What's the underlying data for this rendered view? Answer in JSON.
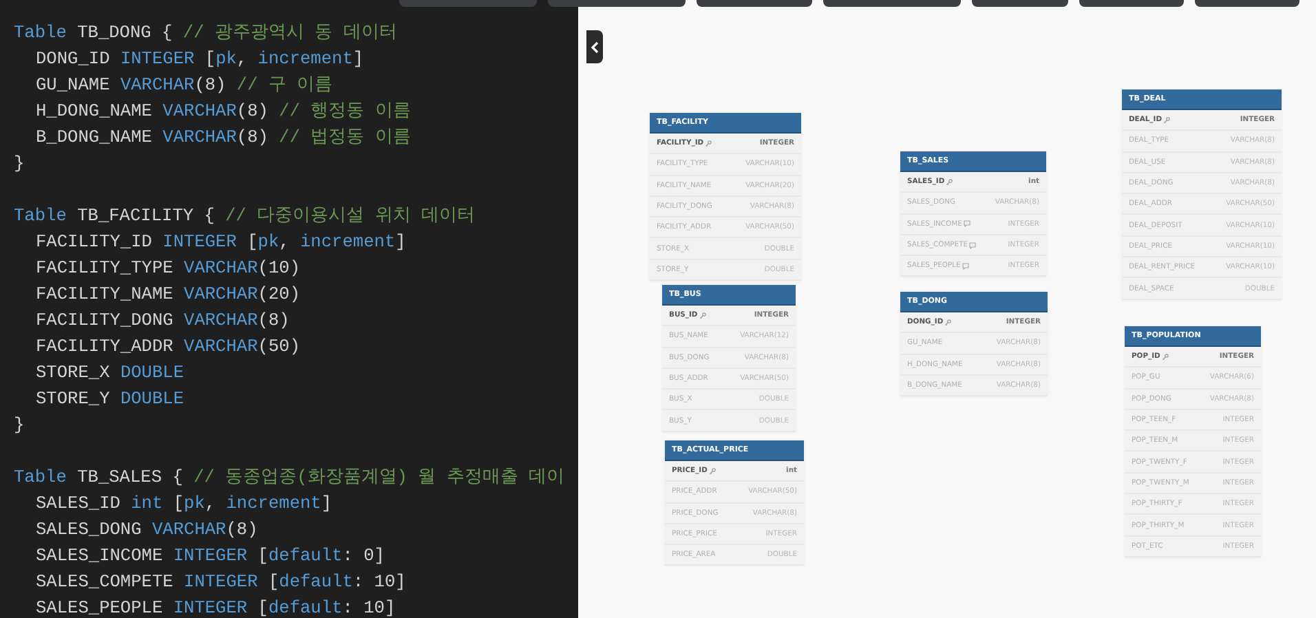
{
  "code": [
    {
      "kind": "code",
      "indented": false,
      "tokens": [
        {
          "kind": "kw",
          "text": "Table"
        },
        {
          "kind": "id",
          "text": " TB_DONG { "
        },
        {
          "kind": "cm",
          "text": "// 광주광역시 동 데이터"
        }
      ]
    },
    {
      "kind": "code",
      "indented": true,
      "tokens": [
        {
          "kind": "id",
          "text": "DONG_ID "
        },
        {
          "kind": "kw",
          "text": "INTEGER"
        },
        {
          "kind": "id",
          "text": " ["
        },
        {
          "kind": "kw",
          "text": "pk"
        },
        {
          "kind": "id",
          "text": ", "
        },
        {
          "kind": "kw",
          "text": "increment"
        },
        {
          "kind": "id",
          "text": "]"
        }
      ]
    },
    {
      "kind": "code",
      "indented": true,
      "tokens": [
        {
          "kind": "id",
          "text": "GU_NAME "
        },
        {
          "kind": "kw",
          "text": "VARCHAR"
        },
        {
          "kind": "id",
          "text": "(8) "
        },
        {
          "kind": "cm",
          "text": "// 구 이름"
        }
      ]
    },
    {
      "kind": "code",
      "indented": true,
      "tokens": [
        {
          "kind": "id",
          "text": "H_DONG_NAME "
        },
        {
          "kind": "kw",
          "text": "VARCHAR"
        },
        {
          "kind": "id",
          "text": "(8) "
        },
        {
          "kind": "cm",
          "text": "// 행정동 이름"
        }
      ]
    },
    {
      "kind": "code",
      "indented": true,
      "tokens": [
        {
          "kind": "id",
          "text": "B_DONG_NAME "
        },
        {
          "kind": "kw",
          "text": "VARCHAR"
        },
        {
          "kind": "id",
          "text": "(8) "
        },
        {
          "kind": "cm",
          "text": "// 법정동 이름"
        }
      ]
    },
    {
      "kind": "code",
      "indented": false,
      "tokens": [
        {
          "kind": "id",
          "text": "}"
        }
      ]
    },
    {
      "kind": "blank"
    },
    {
      "kind": "code",
      "indented": false,
      "tokens": [
        {
          "kind": "kw",
          "text": "Table"
        },
        {
          "kind": "id",
          "text": " TB_FACILITY { "
        },
        {
          "kind": "cm",
          "text": "// 다중이용시설 위치 데이터"
        }
      ]
    },
    {
      "kind": "code",
      "indented": true,
      "tokens": [
        {
          "kind": "id",
          "text": "FACILITY_ID "
        },
        {
          "kind": "kw",
          "text": "INTEGER"
        },
        {
          "kind": "id",
          "text": " ["
        },
        {
          "kind": "kw",
          "text": "pk"
        },
        {
          "kind": "id",
          "text": ", "
        },
        {
          "kind": "kw",
          "text": "increment"
        },
        {
          "kind": "id",
          "text": "]"
        }
      ]
    },
    {
      "kind": "code",
      "indented": true,
      "tokens": [
        {
          "kind": "id",
          "text": "FACILITY_TYPE "
        },
        {
          "kind": "kw",
          "text": "VARCHAR"
        },
        {
          "kind": "id",
          "text": "(10)"
        }
      ]
    },
    {
      "kind": "code",
      "indented": true,
      "tokens": [
        {
          "kind": "id",
          "text": "FACILITY_NAME "
        },
        {
          "kind": "kw",
          "text": "VARCHAR"
        },
        {
          "kind": "id",
          "text": "(20)"
        }
      ]
    },
    {
      "kind": "code",
      "indented": true,
      "tokens": [
        {
          "kind": "id",
          "text": "FACILITY_DONG "
        },
        {
          "kind": "kw",
          "text": "VARCHAR"
        },
        {
          "kind": "id",
          "text": "(8)"
        }
      ]
    },
    {
      "kind": "code",
      "indented": true,
      "tokens": [
        {
          "kind": "id",
          "text": "FACILITY_ADDR "
        },
        {
          "kind": "kw",
          "text": "VARCHAR"
        },
        {
          "kind": "id",
          "text": "(50)"
        }
      ]
    },
    {
      "kind": "code",
      "indented": true,
      "tokens": [
        {
          "kind": "id",
          "text": "STORE_X "
        },
        {
          "kind": "kw",
          "text": "DOUBLE"
        }
      ]
    },
    {
      "kind": "code",
      "indented": true,
      "tokens": [
        {
          "kind": "id",
          "text": "STORE_Y "
        },
        {
          "kind": "kw",
          "text": "DOUBLE"
        }
      ]
    },
    {
      "kind": "code",
      "indented": false,
      "tokens": [
        {
          "kind": "id",
          "text": "}"
        }
      ]
    },
    {
      "kind": "blank"
    },
    {
      "kind": "code",
      "indented": false,
      "tokens": [
        {
          "kind": "kw",
          "text": "Table"
        },
        {
          "kind": "id",
          "text": " TB_SALES { "
        },
        {
          "kind": "cm",
          "text": "// 동종업종(화장품계열) 월 추정매출 데이"
        }
      ]
    },
    {
      "kind": "code",
      "indented": true,
      "tokens": [
        {
          "kind": "id",
          "text": "SALES_ID "
        },
        {
          "kind": "kw",
          "text": "int"
        },
        {
          "kind": "id",
          "text": " ["
        },
        {
          "kind": "kw",
          "text": "pk"
        },
        {
          "kind": "id",
          "text": ", "
        },
        {
          "kind": "kw",
          "text": "increment"
        },
        {
          "kind": "id",
          "text": "]"
        }
      ]
    },
    {
      "kind": "code",
      "indented": true,
      "tokens": [
        {
          "kind": "id",
          "text": "SALES_DONG "
        },
        {
          "kind": "kw",
          "text": "VARCHAR"
        },
        {
          "kind": "id",
          "text": "(8)"
        }
      ]
    },
    {
      "kind": "code",
      "indented": true,
      "tokens": [
        {
          "kind": "id",
          "text": "SALES_INCOME "
        },
        {
          "kind": "kw",
          "text": "INTEGER"
        },
        {
          "kind": "id",
          "text": " ["
        },
        {
          "kind": "kw",
          "text": "default"
        },
        {
          "kind": "id",
          "text": ": 0]"
        }
      ]
    },
    {
      "kind": "code",
      "indented": true,
      "tokens": [
        {
          "kind": "id",
          "text": "SALES_COMPETE "
        },
        {
          "kind": "kw",
          "text": "INTEGER"
        },
        {
          "kind": "id",
          "text": " ["
        },
        {
          "kind": "kw",
          "text": "default"
        },
        {
          "kind": "id",
          "text": ": 10]"
        }
      ]
    },
    {
      "kind": "code",
      "indented": true,
      "tokens": [
        {
          "kind": "id",
          "text": "SALES_PEOPLE "
        },
        {
          "kind": "kw",
          "text": "INTEGER"
        },
        {
          "kind": "id",
          "text": " ["
        },
        {
          "kind": "kw",
          "text": "default"
        },
        {
          "kind": "id",
          "text": ": 10]"
        }
      ]
    }
  ],
  "tables": [
    {
      "name": "TB_FACILITY",
      "fields": [
        {
          "name": "FACILITY_ID",
          "type": "INTEGER",
          "pk": true,
          "note": false
        },
        {
          "name": "FACILITY_TYPE",
          "type": "VARCHAR(10)",
          "pk": false,
          "note": false
        },
        {
          "name": "FACILITY_NAME",
          "type": "VARCHAR(20)",
          "pk": false,
          "note": false
        },
        {
          "name": "FACILITY_DONG",
          "type": "VARCHAR(8)",
          "pk": false,
          "note": false
        },
        {
          "name": "FACILITY_ADDR",
          "type": "VARCHAR(50)",
          "pk": false,
          "note": false
        },
        {
          "name": "STORE_X",
          "type": "DOUBLE",
          "pk": false,
          "note": false
        },
        {
          "name": "STORE_Y",
          "type": "DOUBLE",
          "pk": false,
          "note": false
        }
      ]
    },
    {
      "name": "TB_BUS",
      "fields": [
        {
          "name": "BUS_ID",
          "type": "INTEGER",
          "pk": true,
          "note": false
        },
        {
          "name": "BUS_NAME",
          "type": "VARCHAR(12)",
          "pk": false,
          "note": false
        },
        {
          "name": "BUS_DONG",
          "type": "VARCHAR(8)",
          "pk": false,
          "note": false
        },
        {
          "name": "BUS_ADDR",
          "type": "VARCHAR(50)",
          "pk": false,
          "note": false
        },
        {
          "name": "BUS_X",
          "type": "DOUBLE",
          "pk": false,
          "note": false
        },
        {
          "name": "BUS_Y",
          "type": "DOUBLE",
          "pk": false,
          "note": false
        }
      ]
    },
    {
      "name": "TB_ACTUAL_PRICE",
      "fields": [
        {
          "name": "PRICE_ID",
          "type": "int",
          "pk": true,
          "note": false
        },
        {
          "name": "PRICE_ADDR",
          "type": "VARCHAR(50)",
          "pk": false,
          "note": false
        },
        {
          "name": "PRICE_DONG",
          "type": "VARCHAR(8)",
          "pk": false,
          "note": false
        },
        {
          "name": "PRICE_PRICE",
          "type": "INTEGER",
          "pk": false,
          "note": false
        },
        {
          "name": "PRICE_AREA",
          "type": "DOUBLE",
          "pk": false,
          "note": false
        }
      ]
    },
    {
      "name": "TB_SALES",
      "fields": [
        {
          "name": "SALES_ID",
          "type": "int",
          "pk": true,
          "note": false
        },
        {
          "name": "SALES_DONG",
          "type": "VARCHAR(8)",
          "pk": false,
          "note": false
        },
        {
          "name": "SALES_INCOME",
          "type": "INTEGER",
          "pk": false,
          "note": true
        },
        {
          "name": "SALES_COMPETE",
          "type": "INTEGER",
          "pk": false,
          "note": true
        },
        {
          "name": "SALES_PEOPLE",
          "type": "INTEGER",
          "pk": false,
          "note": true
        }
      ]
    },
    {
      "name": "TB_DONG",
      "fields": [
        {
          "name": "DONG_ID",
          "type": "INTEGER",
          "pk": true,
          "note": false
        },
        {
          "name": "GU_NAME",
          "type": "VARCHAR(8)",
          "pk": false,
          "note": false
        },
        {
          "name": "H_DONG_NAME",
          "type": "VARCHAR(8)",
          "pk": false,
          "note": false
        },
        {
          "name": "B_DONG_NAME",
          "type": "VARCHAR(8)",
          "pk": false,
          "note": false
        }
      ]
    },
    {
      "name": "TB_DEAL",
      "fields": [
        {
          "name": "DEAL_ID",
          "type": "INTEGER",
          "pk": true,
          "note": false
        },
        {
          "name": "DEAL_TYPE",
          "type": "VARCHAR(8)",
          "pk": false,
          "note": false
        },
        {
          "name": "DEAL_USE",
          "type": "VARCHAR(8)",
          "pk": false,
          "note": false
        },
        {
          "name": "DEAL_DONG",
          "type": "VARCHAR(8)",
          "pk": false,
          "note": false
        },
        {
          "name": "DEAL_ADDR",
          "type": "VARCHAR(50)",
          "pk": false,
          "note": false
        },
        {
          "name": "DEAL_DEPOSIT",
          "type": "VARCHAR(10)",
          "pk": false,
          "note": false
        },
        {
          "name": "DEAL_PRICE",
          "type": "VARCHAR(10)",
          "pk": false,
          "note": false
        },
        {
          "name": "DEAL_RENT_PRICE",
          "type": "VARCHAR(10)",
          "pk": false,
          "note": false
        },
        {
          "name": "DEAL_SPACE",
          "type": "DOUBLE",
          "pk": false,
          "note": false
        }
      ]
    },
    {
      "name": "TB_POPULATION",
      "fields": [
        {
          "name": "POP_ID",
          "type": "INTEGER",
          "pk": true,
          "note": false
        },
        {
          "name": "POP_GU",
          "type": "VARCHAR(6)",
          "pk": false,
          "note": false
        },
        {
          "name": "POP_DONG",
          "type": "VARCHAR(8)",
          "pk": false,
          "note": false
        },
        {
          "name": "POP_TEEN_F",
          "type": "INTEGER",
          "pk": false,
          "note": false
        },
        {
          "name": "POP_TEEN_M",
          "type": "INTEGER",
          "pk": false,
          "note": false
        },
        {
          "name": "POP_TWENTY_F",
          "type": "INTEGER",
          "pk": false,
          "note": false
        },
        {
          "name": "POP_TWENTY_M",
          "type": "INTEGER",
          "pk": false,
          "note": false
        },
        {
          "name": "POP_THIRTY_F",
          "type": "INTEGER",
          "pk": false,
          "note": false
        },
        {
          "name": "POP_THIRTY_M",
          "type": "INTEGER",
          "pk": false,
          "note": false
        },
        {
          "name": "POT_ETC",
          "type": "INTEGER",
          "pk": false,
          "note": false
        }
      ]
    }
  ]
}
